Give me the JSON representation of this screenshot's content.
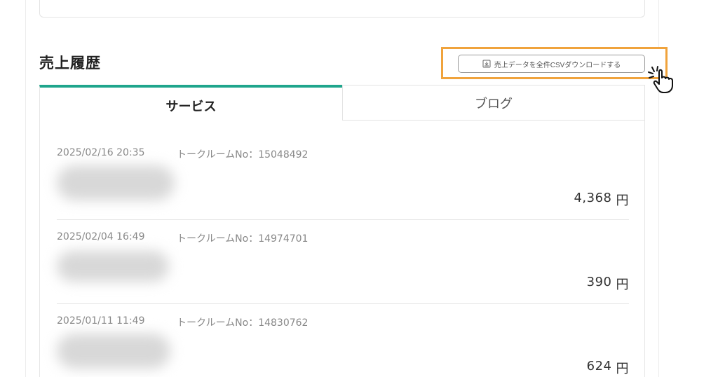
{
  "sales_section": {
    "title": "売上履歴",
    "csv_button_label": "売上データを全件CSVダウンロードする",
    "csv_button_icon": "download-icon",
    "accent_color": "#1fa58c",
    "highlight_color": "#f0a33c"
  },
  "tabs": [
    {
      "label": "サービス",
      "active": true
    },
    {
      "label": "ブログ",
      "active": false
    }
  ],
  "transactions": [
    {
      "date": "2025/02/16 20:35",
      "room": "トークルームNo：15048492",
      "amount": "4,368",
      "currency": "円"
    },
    {
      "date": "2025/02/04 16:49",
      "room": "トークルームNo：14974701",
      "amount": "390",
      "currency": "円"
    },
    {
      "date": "2025/01/11 11:49",
      "room": "トークルームNo：14830762",
      "amount": "624",
      "currency": "円"
    }
  ]
}
